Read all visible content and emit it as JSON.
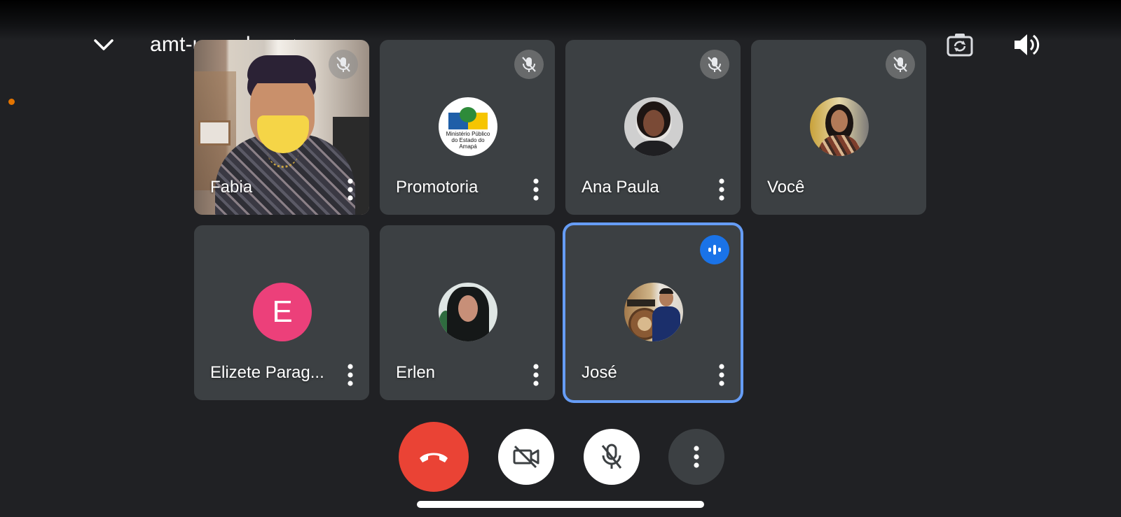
{
  "header": {
    "meeting_code": "amt-uyoq-kqm",
    "collapse_icon": "chevron-down-icon",
    "switch_camera_icon": "camera-switch-icon",
    "speaker_icon": "speaker-icon"
  },
  "participants": [
    {
      "name": "Fabia",
      "type": "video",
      "status": "muted"
    },
    {
      "name": "Promotoria",
      "type": "avatar",
      "status": "muted",
      "avatar_text": "Ministério Público do Estado do Amapá"
    },
    {
      "name": "Ana Paula",
      "type": "avatar",
      "status": "muted"
    },
    {
      "name": "Você",
      "type": "avatar",
      "status": "muted"
    },
    {
      "name": "Elizete Parag...",
      "type": "letter",
      "letter": "E",
      "status": "none"
    },
    {
      "name": "Erlen",
      "type": "avatar",
      "status": "none"
    },
    {
      "name": "José",
      "type": "avatar",
      "status": "speaking",
      "active": true
    }
  ],
  "controls": {
    "end_call_icon": "phone-hangup-icon",
    "camera_icon": "camera-off-icon",
    "mic_icon": "mic-off-icon",
    "more_icon": "more-vert-icon"
  },
  "colors": {
    "background": "#202124",
    "tile": "#3c4043",
    "end_call": "#ea4335",
    "active_border": "#669df6",
    "speaking_badge": "#1a73e8",
    "letter_avatar": "#ec407a"
  }
}
